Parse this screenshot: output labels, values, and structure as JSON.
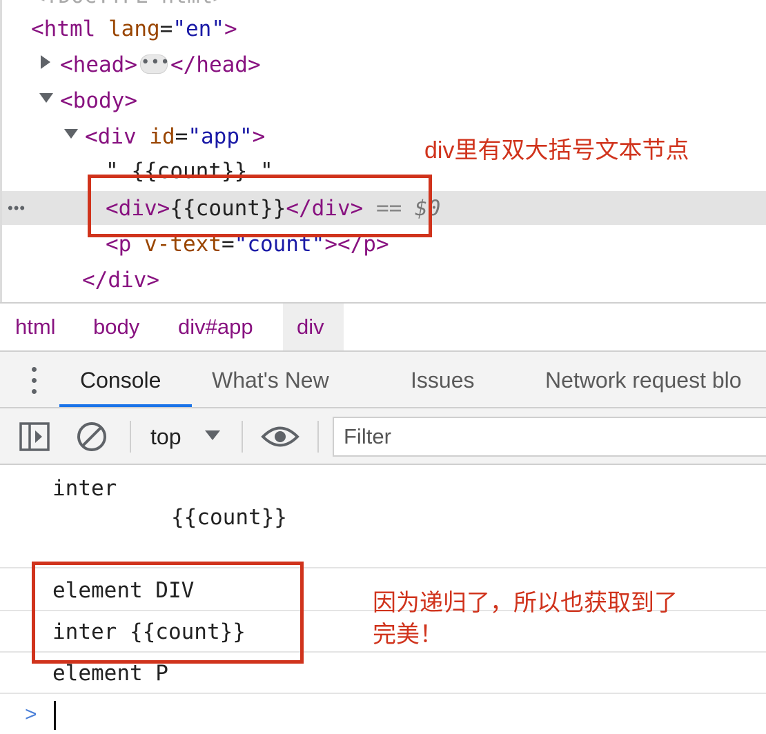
{
  "elements_panel": {
    "html_open": {
      "tag_open": "<html",
      "attr_name": "lang",
      "eq": "=",
      "attr_value": "\"en\"",
      "tag_close": ">"
    },
    "head": {
      "open": "<head>",
      "ellipsis": "•••",
      "close": "</head>"
    },
    "body_open": "<body>",
    "div_app": {
      "tag_open": "<div",
      "attr_name": "id",
      "eq": "=",
      "attr_value": "\"app\"",
      "tag_close": ">"
    },
    "text_node": "\" {{count}} \"",
    "selected_div": {
      "open": "<div>",
      "text": "{{count}}",
      "close": "</div>",
      "eq_marker": "==",
      "dollar": "$0"
    },
    "p_vtext": {
      "tag_open": "<p",
      "attr_name": "v-text",
      "eq": "=",
      "attr_value": "\"count\"",
      "tag_close": "></p>"
    },
    "div_close": "</div>",
    "row_menu": "•••"
  },
  "annotations": {
    "top": "div里有双大括号文本节点",
    "bottom_line1": "因为递归了，所以也获取到了",
    "bottom_line2": "完美！"
  },
  "breadcrumb": [
    "html",
    "body",
    "div#app",
    "div"
  ],
  "drawer_tabs": [
    "Console",
    "What's New",
    "Issues",
    "Network request blo"
  ],
  "toolbar": {
    "context": "top",
    "filter_placeholder": "Filter"
  },
  "console": {
    "line1": "inter",
    "line2": "{{count}}",
    "line3": "element DIV",
    "line4": "inter {{count}}",
    "line5": "element P",
    "prompt": ">"
  },
  "colors": {
    "tag": "#881280",
    "attr": "#994500",
    "value": "#1a1aa6",
    "annotation": "#d0331c",
    "tab_accent": "#1a73e8"
  }
}
